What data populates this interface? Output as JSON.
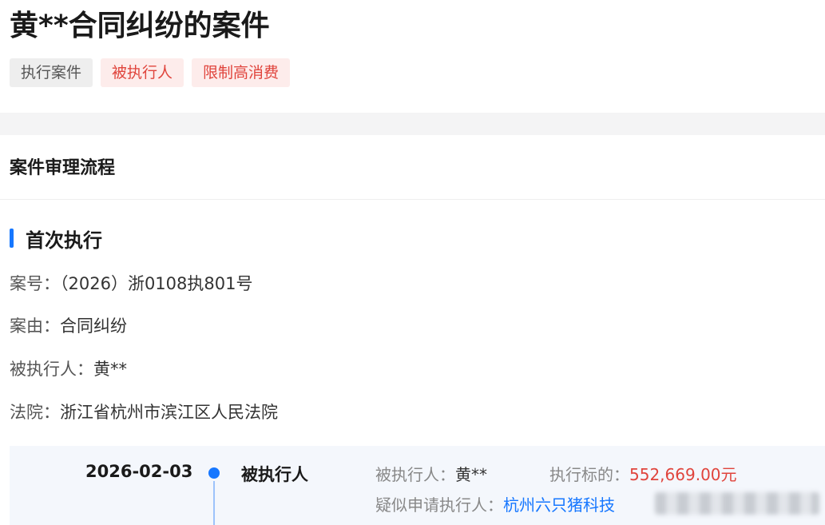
{
  "case": {
    "title": "黄**合同纠纷的案件",
    "tags": [
      {
        "label": "执行案件",
        "style": "gray"
      },
      {
        "label": "被执行人",
        "style": "red"
      },
      {
        "label": "限制高消费",
        "style": "red"
      }
    ]
  },
  "process": {
    "section_title": "案件审理流程",
    "stage_title": "首次执行",
    "fields": [
      {
        "key": "案号：",
        "value": "（2026）浙0108执801号"
      },
      {
        "key": "案由：",
        "value": "合同纠纷"
      },
      {
        "key": "被执行人：",
        "value": "黄**"
      },
      {
        "key": "法院：",
        "value": "浙江省杭州市滨江区人民法院"
      }
    ]
  },
  "timeline": {
    "date": "2026-02-03",
    "role": "被执行人",
    "executed_label": "被执行人：",
    "executed_value": "黄**",
    "amount_label": "执行标的：",
    "amount_value": "552,669.00元",
    "applicant_label": "疑似申请执行人：",
    "applicant_value": "杭州六只猪科技"
  },
  "colors": {
    "accent": "#1677ff",
    "danger": "#e0443c",
    "tag_red_bg": "#fdeceb",
    "tag_gray_bg": "#eeeeee"
  }
}
